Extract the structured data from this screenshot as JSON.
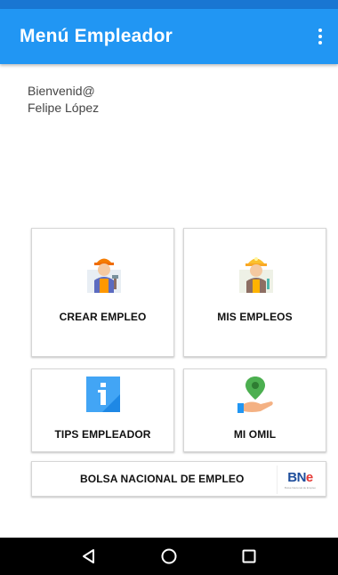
{
  "appbar": {
    "title": "Menú Empleador",
    "menu_icon": "more-vert-icon"
  },
  "welcome": {
    "greeting": "Bienvenid@",
    "user_name": "Felipe López"
  },
  "cards": {
    "crear_empleo": {
      "label": "CREAR EMPLEO",
      "icon": "worker-icon"
    },
    "mis_empleos": {
      "label": "MIS EMPLEOS",
      "icon": "worker-helmet-icon"
    },
    "tips_empleador": {
      "label": "TIPS EMPLEADOR",
      "icon": "info-icon"
    },
    "mi_omil": {
      "label": "MI OMIL",
      "icon": "location-hand-icon"
    }
  },
  "bne_banner": {
    "label": "BOLSA NACIONAL DE EMPLEO",
    "logo_text_b": "BN",
    "logo_text_e": "e",
    "logo_sub": "Bolsa Nacional de Empleo"
  },
  "navbar": {
    "back_icon": "back-icon",
    "home_icon": "home-icon",
    "recents_icon": "recents-icon"
  },
  "colors": {
    "primary": "#2196f3",
    "primary_dark": "#1976d2"
  }
}
